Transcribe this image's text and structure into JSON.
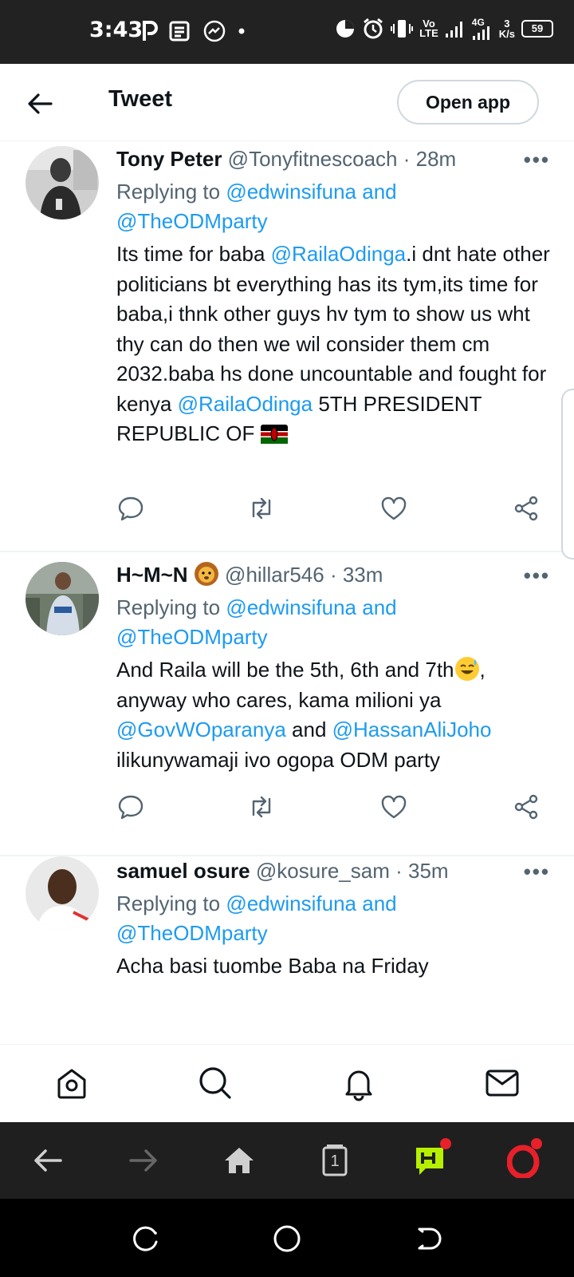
{
  "status_bar": {
    "time": "3:43",
    "network_top": "Vo",
    "network_bottom": "LTE",
    "net_gen": "4G",
    "speed_top": "3",
    "speed_bottom": "K/s",
    "battery": "59"
  },
  "header": {
    "title": "Tweet",
    "open_app": "Open app"
  },
  "tweets": [
    {
      "name": "Tony Peter",
      "handle": "@Tonyfitnescoach",
      "time": "· 28m",
      "reply_prefix": "Replying to",
      "reply_to_1": "@edwinsifuna and",
      "reply_to_2": "@TheODMparty",
      "text_1": "Its time for baba ",
      "mention_1": "@RailaOdinga",
      "text_2": ".i dnt hate other politicians bt everything has its tym,its time for baba,i thnk other guys hv tym to show us wht thy can do then we wil consider them cm 2032.baba hs done uncountable and fought for kenya ",
      "mention_2": "@RailaOdinga",
      "text_3": " 5TH PRESIDENT REPUBLIC OF"
    },
    {
      "name": "H~M~N",
      "handle": "@hillar546",
      "time": "· 33m",
      "reply_prefix": "Replying to",
      "reply_to_1": "@edwinsifuna and",
      "reply_to_2": "@TheODMparty",
      "text_1": "And Raila will be the 5th, 6th and 7th",
      "text_2": ", anyway who cares, kama milioni ya ",
      "mention_1": "@GovWOparanya",
      "text_3": "  and ",
      "mention_2": "@HassanAliJoho",
      "text_4": " ilikunywamaji ivo ogopa ODM party"
    },
    {
      "name": "samuel osure",
      "handle": "@kosure_sam",
      "time": "· 35m",
      "reply_prefix": "Replying to",
      "reply_to_1": "@edwinsifuna and",
      "reply_to_2": "@TheODMparty",
      "text_1": "Acha basi tuombe Baba na Friday"
    }
  ],
  "more_glyph": "•••",
  "browser": {
    "tabs_count": "1"
  },
  "icons": {
    "back": "arrow-left-icon",
    "reply": "comment-icon",
    "retweet": "retweet-icon",
    "like": "heart-icon",
    "share": "share-icon",
    "home": "home-icon",
    "search": "search-icon",
    "notifications": "bell-icon",
    "messages": "mail-icon"
  },
  "colors": {
    "accent": "#1d9bf0",
    "text": "#0f1419",
    "secondary": "#536471"
  }
}
